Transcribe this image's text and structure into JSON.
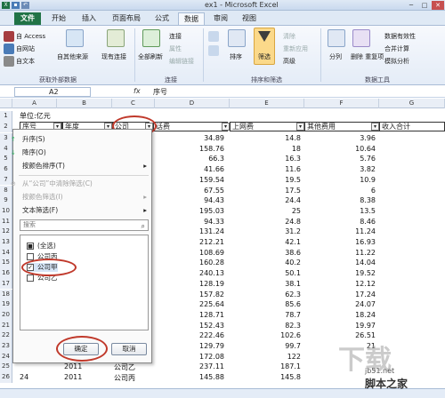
{
  "window": {
    "title": "ex1 - Microsoft Excel",
    "close": "✕",
    "minimize": "─",
    "maximize": "□"
  },
  "tabs": [
    "文件",
    "开始",
    "插入",
    "页面布局",
    "公式",
    "数据",
    "审阅",
    "视图"
  ],
  "ribbon": {
    "external": {
      "access": "自 Access",
      "web": "自网站",
      "text": "自文本",
      "other": "自其他来源",
      "existing": "现有连接",
      "group": "获取外部数据"
    },
    "connections": {
      "refresh": "全部刷新",
      "connections": "连接",
      "properties": "属性",
      "edit_links": "编辑链接",
      "group": "连接"
    },
    "sort_filter": {
      "sort": "排序",
      "filter": "筛选",
      "clear": "清除",
      "reapply": "重新应用",
      "advanced": "高级",
      "group": "排序和筛选"
    },
    "tools": {
      "split": "分列",
      "remove_dup": "删除\n重复项",
      "validation": "数据有效性",
      "consolidate": "合并计算",
      "whatif": "模拟分析",
      "group": "数据工具"
    }
  },
  "formula_bar": {
    "name_box": "A2",
    "fx": "fx",
    "content": "序号"
  },
  "columns": [
    "A",
    "B",
    "C",
    "D",
    "E",
    "F",
    "G"
  ],
  "sheet": {
    "row1_text": "单位:亿元",
    "headers": [
      "序号",
      "年度",
      "公司",
      "话费",
      "上网费",
      "其他费用",
      "收入合计"
    ],
    "rows": [
      [
        "",
        "",
        "",
        "34.89",
        "14.8",
        "3.96"
      ],
      [
        "",
        "",
        "",
        "158.76",
        "18",
        "10.64"
      ],
      [
        "",
        "",
        "",
        "66.3",
        "16.3",
        "5.76"
      ],
      [
        "",
        "",
        "",
        "41.66",
        "11.6",
        "3.82"
      ],
      [
        "",
        "",
        "",
        "159.54",
        "19.5",
        "10.9"
      ],
      [
        "",
        "",
        "",
        "67.55",
        "17.5",
        "6"
      ],
      [
        "",
        "",
        "",
        "94.43",
        "24.4",
        "8.38"
      ],
      [
        "",
        "",
        "",
        "195.03",
        "25",
        "13.5"
      ],
      [
        "",
        "",
        "",
        "94.33",
        "24.8",
        "8.46"
      ],
      [
        "",
        "",
        "",
        "131.24",
        "31.2",
        "11.24"
      ],
      [
        "",
        "",
        "",
        "212.21",
        "42.1",
        "16.93"
      ],
      [
        "",
        "",
        "",
        "108.69",
        "38.6",
        "11.22"
      ],
      [
        "",
        "",
        "",
        "160.28",
        "40.2",
        "14.04"
      ],
      [
        "",
        "",
        "",
        "240.13",
        "50.1",
        "19.52"
      ],
      [
        "",
        "",
        "",
        "128.19",
        "38.1",
        "12.12"
      ],
      [
        "",
        "",
        "",
        "157.82",
        "62.3",
        "17.24"
      ],
      [
        "",
        "",
        "",
        "225.64",
        "85.6",
        "24.07"
      ],
      [
        "",
        "",
        "",
        "128.71",
        "78.7",
        "18.24"
      ],
      [
        "",
        "",
        "",
        "152.43",
        "82.3",
        "19.97"
      ],
      [
        "",
        "",
        "",
        "222.46",
        "102.6",
        "26.51"
      ],
      [
        "",
        "",
        "",
        "129.79",
        "99.7",
        "21"
      ],
      [
        "",
        "",
        "",
        "172.08",
        "122",
        ""
      ],
      [
        "",
        "2011",
        "公司乙",
        "237.11",
        "187.1",
        ""
      ],
      [
        "24",
        "2011",
        "公司丙",
        "145.88",
        "145.8",
        ""
      ]
    ]
  },
  "filter_menu": {
    "sort_asc": "升序(S)",
    "sort_desc": "降序(O)",
    "sort_color": "按颜色排序(T)",
    "clear_filter": "从“公司”中清除筛选(C)",
    "filter_color": "按颜色筛选(I)",
    "text_filter": "文本筛选(F)",
    "search_placeholder": "搜索",
    "items": [
      {
        "label": "(全选)",
        "state": "partial"
      },
      {
        "label": "公司丙",
        "state": "unchecked"
      },
      {
        "label": "公司甲",
        "state": "checked"
      },
      {
        "label": "公司乙",
        "state": "unchecked"
      }
    ],
    "ok": "确定",
    "cancel": "取消"
  },
  "watermark": {
    "logo": "下载",
    "site": "jb51.net",
    "name": "脚本之家"
  },
  "colors": {
    "file_tab": "#217346",
    "highlight_oval": "#c0392b",
    "ribbon_bg": "#e4ecf7"
  }
}
